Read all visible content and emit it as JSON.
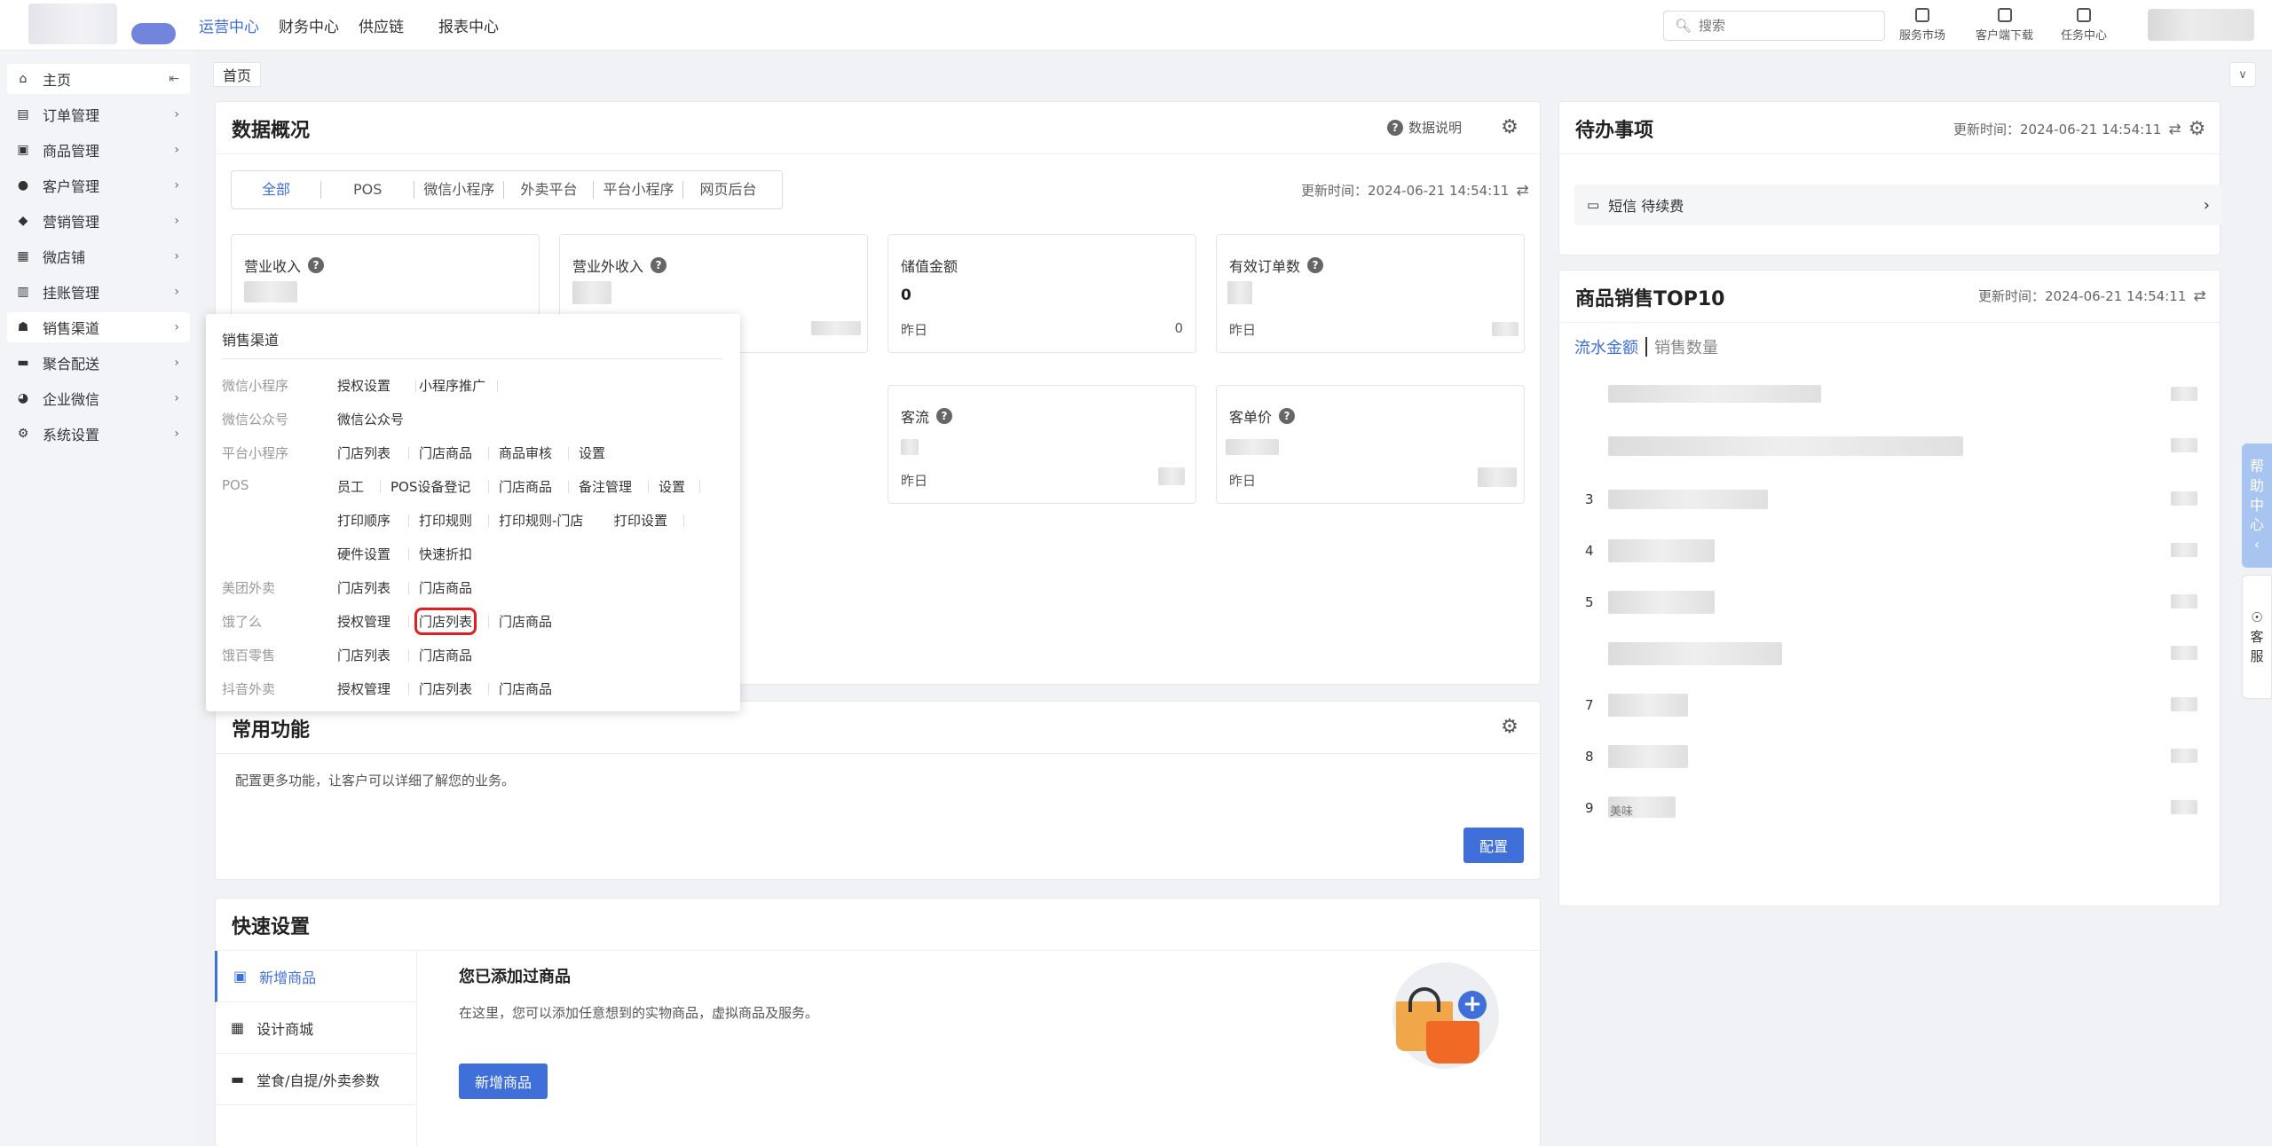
{
  "topbar": {
    "nav": [
      "运营中心",
      "财务中心",
      "供应链",
      "报表中心"
    ],
    "search_placeholder": "搜索",
    "tools": [
      "服务市场",
      "客户端下载",
      "任务中心"
    ]
  },
  "sidebar": {
    "items": [
      {
        "label": "主页",
        "icon": "home-icon"
      },
      {
        "label": "订单管理",
        "icon": "order-icon"
      },
      {
        "label": "商品管理",
        "icon": "goods-icon"
      },
      {
        "label": "客户管理",
        "icon": "user-icon"
      },
      {
        "label": "营销管理",
        "icon": "tag-icon"
      },
      {
        "label": "微店铺",
        "icon": "store-icon"
      },
      {
        "label": "挂账管理",
        "icon": "ledger-icon"
      },
      {
        "label": "销售渠道",
        "icon": "channel-icon"
      },
      {
        "label": "聚合配送",
        "icon": "truck-icon"
      },
      {
        "label": "企业微信",
        "icon": "wechat-icon"
      },
      {
        "label": "系统设置",
        "icon": "gear-icon"
      }
    ]
  },
  "breadcrumb": {
    "home": "首页"
  },
  "overview": {
    "title": "数据概况",
    "help": "数据说明",
    "tabs": [
      "全部",
      "POS",
      "微信小程序",
      "外卖平台",
      "平台小程序",
      "网页后台"
    ],
    "update_time": "更新时间：2024-06-21 14:54:11",
    "metrics": [
      {
        "label": "营业收入",
        "value": "",
        "sub": ""
      },
      {
        "label": "营业外收入",
        "value": "",
        "sub": ""
      },
      {
        "label": "储值金额",
        "value": "0",
        "sub": "昨日",
        "subval": "0"
      },
      {
        "label": "有效订单数",
        "value": "",
        "sub": "昨日"
      },
      {
        "label": "客流",
        "value": "",
        "sub": "昨日"
      },
      {
        "label": "客单价",
        "value": "",
        "sub": "昨日"
      }
    ]
  },
  "popup": {
    "title": "销售渠道",
    "rows": [
      {
        "label": "微信小程序",
        "links": [
          "授权设置",
          "小程序推广"
        ]
      },
      {
        "label": "微信公众号",
        "links": [
          "微信公众号"
        ]
      },
      {
        "label": "平台小程序",
        "links": [
          "门店列表",
          "门店商品",
          "商品审核",
          "设置"
        ]
      },
      {
        "label": "POS",
        "links": [
          "员工",
          "POS设备登记",
          "门店商品",
          "备注管理",
          "设置"
        ]
      },
      {
        "label": "",
        "links": [
          "打印顺序",
          "打印规则",
          "打印规则-门店",
          "打印设置"
        ]
      },
      {
        "label": "",
        "links": [
          "硬件设置",
          "快速折扣"
        ]
      },
      {
        "label": "美团外卖",
        "links": [
          "门店列表",
          "门店商品"
        ]
      },
      {
        "label": "饿了么",
        "links": [
          "授权管理",
          "门店列表",
          "门店商品"
        ]
      },
      {
        "label": "饿百零售",
        "links": [
          "门店列表",
          "门店商品"
        ]
      },
      {
        "label": "抖音外卖",
        "links": [
          "授权管理",
          "门店列表",
          "门店商品"
        ]
      }
    ]
  },
  "common": {
    "title": "常用功能",
    "desc": "配置更多功能，让客户可以详细了解您的业务。",
    "button": "配置"
  },
  "quick": {
    "title": "快速设置",
    "items": [
      "新增商品",
      "设计商城",
      "堂食/自提/外卖参数"
    ],
    "content_title": "您已添加过商品",
    "content_desc": "在这里，您可以添加任意想到的实物商品，虚拟商品及服务。",
    "button": "新增商品"
  },
  "todo": {
    "title": "待办事项",
    "update_time": "更新时间：2024-06-21 14:54:11",
    "row": "短信 待续费"
  },
  "top10": {
    "title": "商品销售TOP10",
    "update_time": "更新时间：2024-06-21 14:54:11",
    "tabs": [
      "流水金额",
      "销售数量"
    ],
    "ranks": [
      "",
      "",
      "3",
      "4",
      "5",
      "",
      "7",
      "8",
      "9"
    ],
    "partial_text": "美味"
  },
  "float": {
    "help": [
      "帮",
      "助",
      "中",
      "心"
    ],
    "kefu": [
      "客",
      "服"
    ]
  }
}
